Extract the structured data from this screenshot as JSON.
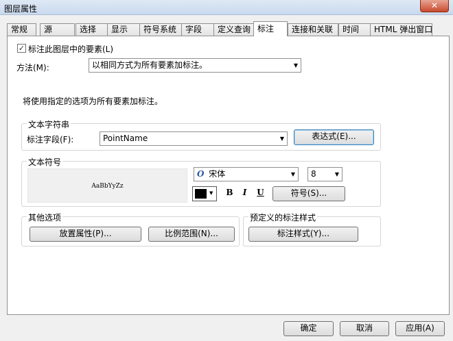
{
  "window": {
    "title": "图层属性",
    "close_glyph": "✕"
  },
  "tabs": [
    {
      "label": "常规"
    },
    {
      "label": "源"
    },
    {
      "label": "选择"
    },
    {
      "label": "显示"
    },
    {
      "label": "符号系统"
    },
    {
      "label": "字段"
    },
    {
      "label": "定义查询"
    },
    {
      "label": "标注"
    },
    {
      "label": "连接和关联"
    },
    {
      "label": "时间"
    },
    {
      "label": "HTML 弹出窗口"
    }
  ],
  "active_tab": "标注",
  "label_features": {
    "label": "标注此图层中的要素(L)",
    "checked": true,
    "check_glyph": "✓"
  },
  "method": {
    "label": "方法(M):",
    "value": "以相同方式为所有要素加标注。"
  },
  "info_text": "将使用指定的选项为所有要素加标注。",
  "text_string": {
    "legend": "文本字符串",
    "field_label": "标注字段(F):",
    "field_value": "PointName",
    "expression_button": "表达式(E)..."
  },
  "text_symbol": {
    "legend": "文本符号",
    "preview_text": "AaBbYyZz",
    "font_icon_glyph": "O",
    "font_name": "宋体",
    "font_size": "8",
    "color": "#000000",
    "bold_glyph": "B",
    "italic_glyph": "I",
    "underline_glyph": "U",
    "symbol_button": "符号(S)..."
  },
  "other_options": {
    "legend": "其他选项",
    "placement_button": "放置属性(P)...",
    "scale_button": "比例范围(N)..."
  },
  "predefined": {
    "legend": "预定义的标注样式",
    "style_button": "标注样式(Y)..."
  },
  "footer": {
    "ok": "确定",
    "cancel": "取消",
    "apply": "应用(A)"
  },
  "dropdown_arrow_glyph": "▼"
}
